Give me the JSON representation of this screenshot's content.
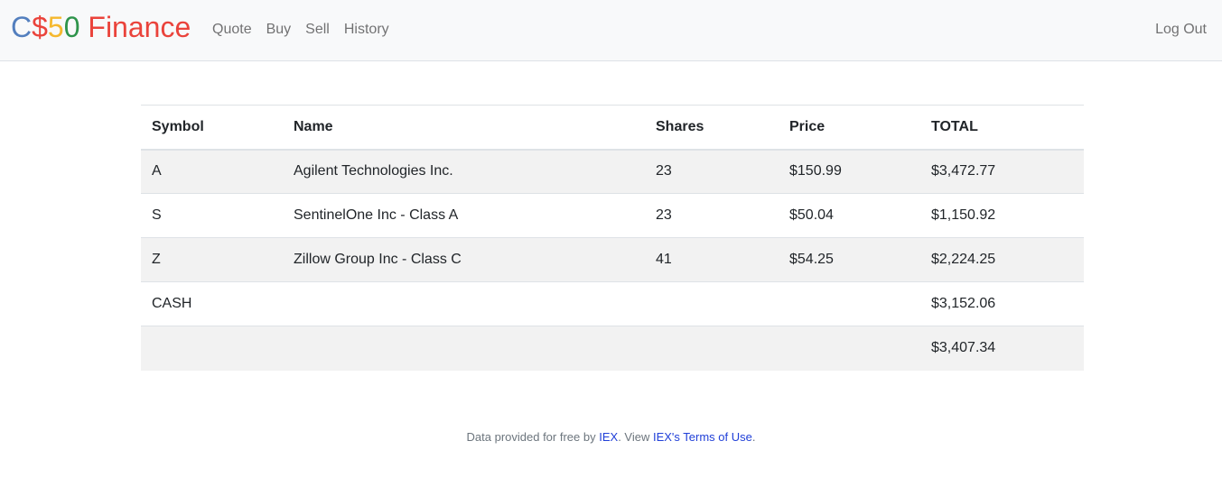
{
  "brand": {
    "parts": [
      {
        "text": "C",
        "color": "#537fbe"
      },
      {
        "text": "$",
        "color": "#ea433b"
      },
      {
        "text": "5",
        "color": "#f5b82e"
      },
      {
        "text": "0",
        "color": "#2e944b"
      },
      {
        "text": " Finance",
        "color": "#ea433b"
      }
    ]
  },
  "nav": {
    "items": [
      "Quote",
      "Buy",
      "Sell",
      "History"
    ],
    "logout": "Log Out"
  },
  "table": {
    "headers": [
      "Symbol",
      "Name",
      "Shares",
      "Price",
      "TOTAL"
    ],
    "rows": [
      {
        "symbol": "A",
        "name": "Agilent Technologies Inc.",
        "shares": "23",
        "price": "$150.99",
        "total": "$3,472.77"
      },
      {
        "symbol": "S",
        "name": "SentinelOne Inc - Class A",
        "shares": "23",
        "price": "$50.04",
        "total": "$1,150.92"
      },
      {
        "symbol": "Z",
        "name": "Zillow Group Inc - Class C",
        "shares": "41",
        "price": "$54.25",
        "total": "$2,224.25"
      }
    ],
    "cash_label": "CASH",
    "cash_total": "$3,152.06",
    "grand_total": "$3,407.34"
  },
  "footer": {
    "prefix": "Data provided for free by ",
    "iex_link": "IEX",
    "middle": ". View ",
    "terms_link": "IEX's Terms of Use",
    "suffix": "."
  },
  "colors": {
    "navbar_bg": "#f8f9fa",
    "link": "#2140d8",
    "stripe": "#f2f2f2"
  }
}
